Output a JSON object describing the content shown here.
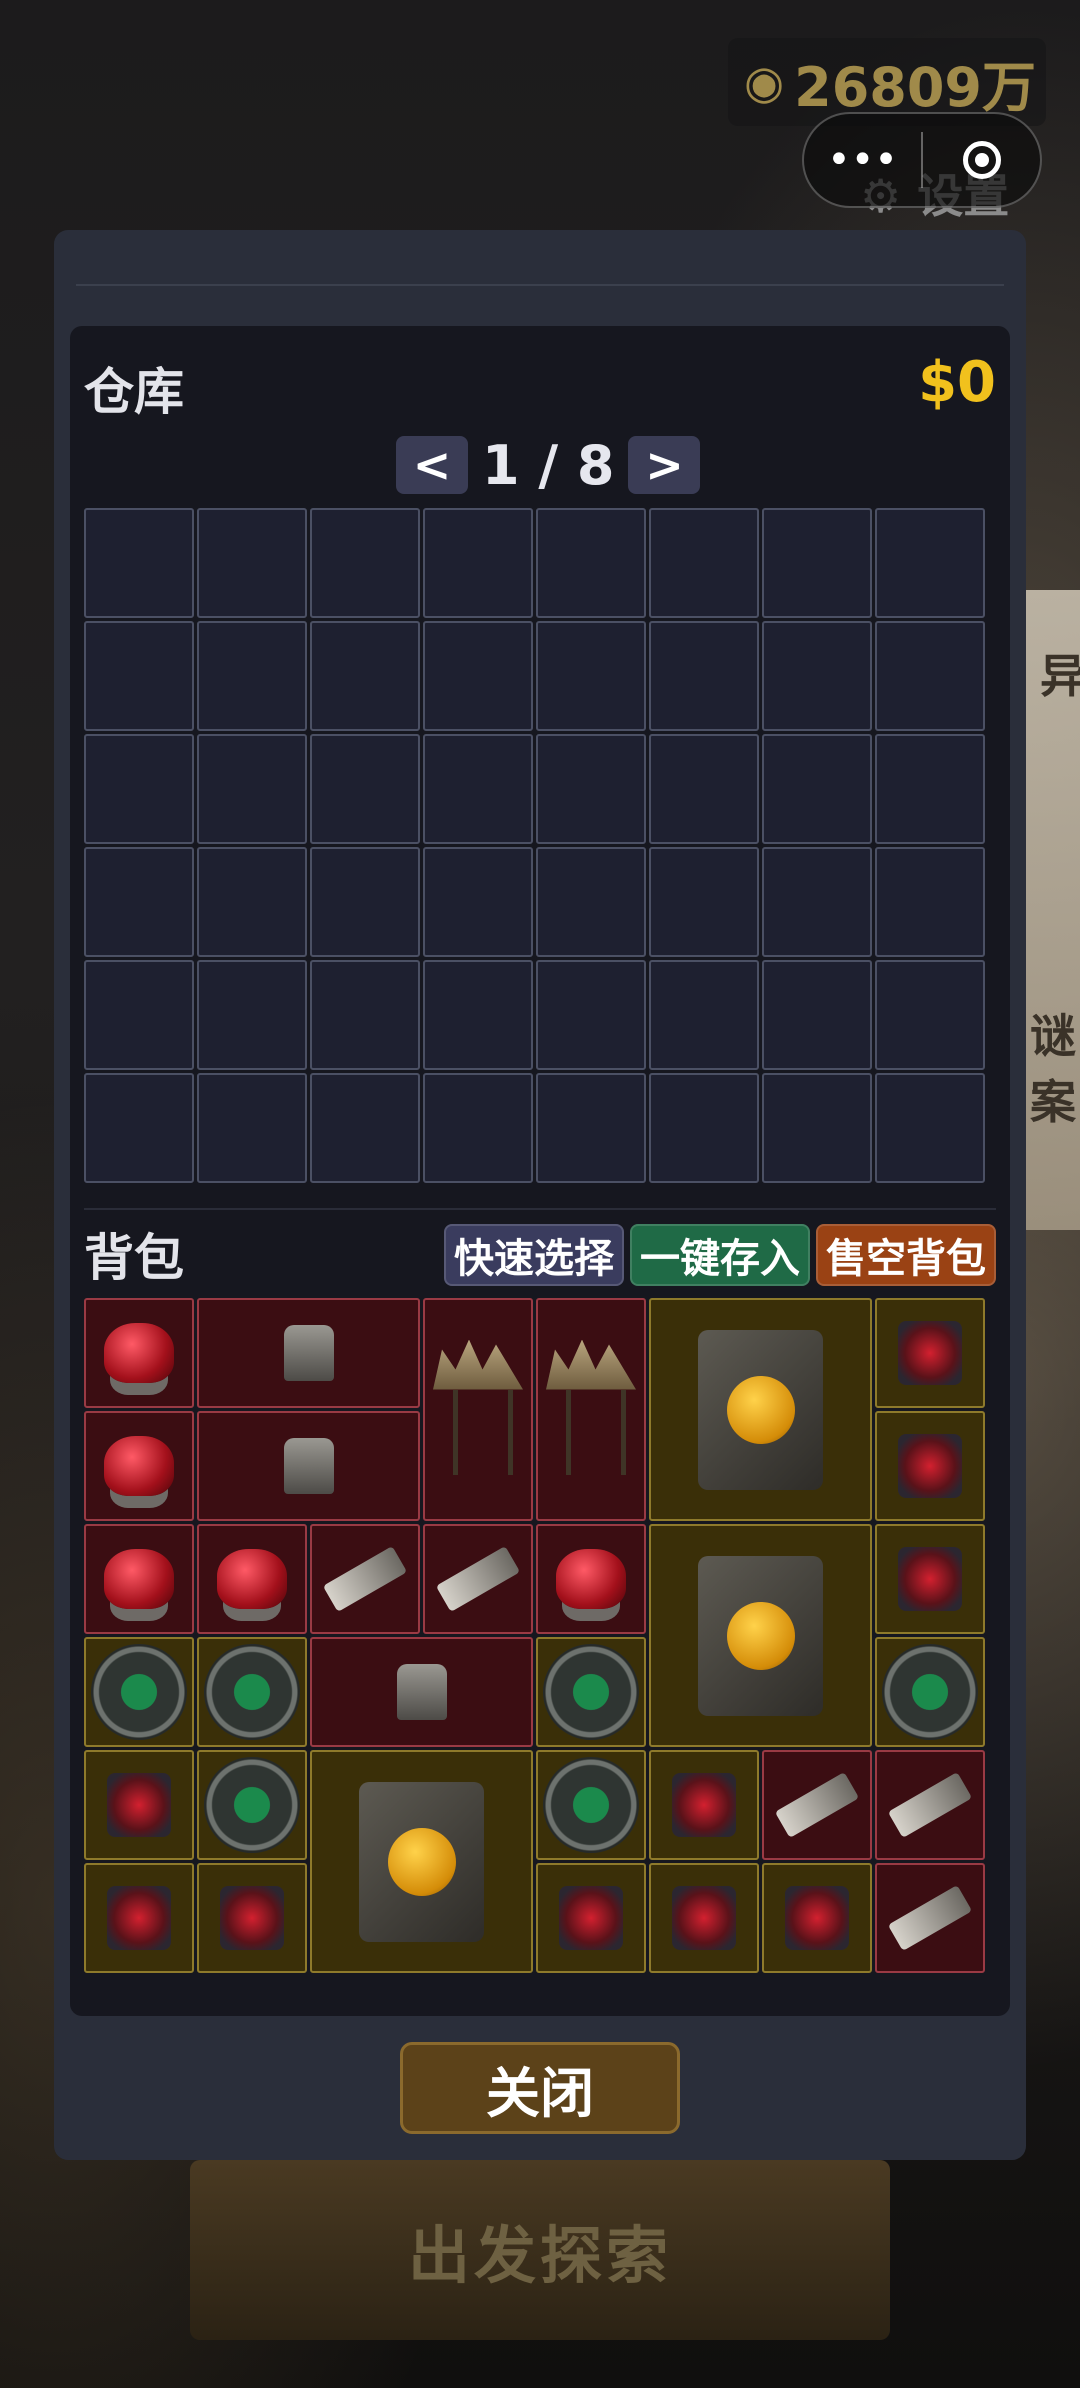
{
  "hud": {
    "money_icon": "money-bag-icon",
    "money": "26809万",
    "settings_label": "设置"
  },
  "capsule": {
    "more_icon": "more-dots-icon",
    "close_icon": "miniprogram-close-icon"
  },
  "background": {
    "explore_label": "出发探索",
    "paper_text_1": "异",
    "paper_text_2": "谜案"
  },
  "warehouse": {
    "title": "仓库",
    "money": "$0",
    "prev_label": "<",
    "next_label": ">",
    "page_text": "1 / 8",
    "columns": 8,
    "rows": 6
  },
  "backpack": {
    "title": "背包",
    "quick_select": "快速选择",
    "deposit_all": "一键存入",
    "sell_all": "售空背包",
    "colors": {
      "red_rarity": "#3b0d12",
      "gold_rarity": "#3a2f08"
    },
    "items": [
      {
        "name": "item-red-gem",
        "type": "gem",
        "rarity": "red"
      },
      {
        "name": "item-stone-totem",
        "type": "totem",
        "rarity": "red"
      },
      {
        "name": "item-crown-relic",
        "type": "crown",
        "rarity": "red"
      },
      {
        "name": "item-crown-relic",
        "type": "crown",
        "rarity": "red"
      },
      {
        "name": "item-amber-tablet",
        "type": "tablet",
        "rarity": "gold"
      },
      {
        "name": "item-red-splinter",
        "type": "splinter",
        "rarity": "gold"
      },
      {
        "name": "item-red-gem",
        "type": "gem",
        "rarity": "red"
      },
      {
        "name": "item-stone-totem",
        "type": "totem",
        "rarity": "red"
      },
      {
        "name": "item-red-splinter",
        "type": "splinter",
        "rarity": "gold"
      },
      {
        "name": "item-red-gem",
        "type": "gem",
        "rarity": "red"
      },
      {
        "name": "item-red-gem",
        "type": "gem",
        "rarity": "red"
      },
      {
        "name": "item-bone-shard",
        "type": "shard",
        "rarity": "red"
      },
      {
        "name": "item-bone-shard",
        "type": "shard",
        "rarity": "red"
      },
      {
        "name": "item-red-gem",
        "type": "gem",
        "rarity": "red"
      },
      {
        "name": "item-amber-tablet",
        "type": "tablet",
        "rarity": "gold"
      },
      {
        "name": "item-red-splinter",
        "type": "splinter",
        "rarity": "gold"
      },
      {
        "name": "item-emerald-orb",
        "type": "orb",
        "rarity": "gold"
      },
      {
        "name": "item-emerald-orb",
        "type": "orb",
        "rarity": "gold"
      },
      {
        "name": "item-stone-totem",
        "type": "totem",
        "rarity": "red"
      },
      {
        "name": "item-emerald-orb",
        "type": "orb",
        "rarity": "gold"
      },
      {
        "name": "item-emerald-orb",
        "type": "orb",
        "rarity": "gold"
      },
      {
        "name": "item-red-splinter",
        "type": "splinter",
        "rarity": "gold"
      },
      {
        "name": "item-emerald-orb",
        "type": "orb",
        "rarity": "gold"
      },
      {
        "name": "item-amber-tablet",
        "type": "tablet",
        "rarity": "gold"
      },
      {
        "name": "item-emerald-orb",
        "type": "orb",
        "rarity": "gold"
      },
      {
        "name": "item-red-splinter",
        "type": "splinter",
        "rarity": "gold"
      },
      {
        "name": "item-bone-shard",
        "type": "shard",
        "rarity": "red"
      },
      {
        "name": "item-bone-shard",
        "type": "shard",
        "rarity": "red"
      },
      {
        "name": "item-red-splinter",
        "type": "splinter",
        "rarity": "gold"
      },
      {
        "name": "item-red-splinter",
        "type": "splinter",
        "rarity": "gold"
      },
      {
        "name": "item-red-splinter",
        "type": "splinter",
        "rarity": "gold"
      },
      {
        "name": "item-red-splinter",
        "type": "splinter",
        "rarity": "gold"
      },
      {
        "name": "item-red-splinter",
        "type": "splinter",
        "rarity": "gold"
      },
      {
        "name": "item-bone-shard",
        "type": "shard",
        "rarity": "red"
      }
    ]
  },
  "close_label": "关闭"
}
